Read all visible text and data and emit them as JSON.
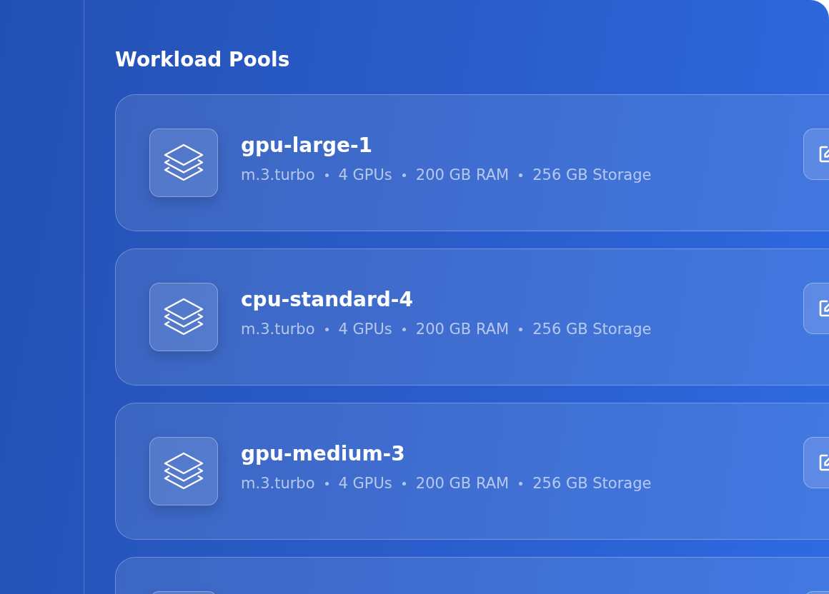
{
  "section": {
    "title": "Workload Pools"
  },
  "pools": [
    {
      "kind": "full",
      "name": "gpu-large-1",
      "specs": [
        "m.3.turbo",
        "4 GPUs",
        "200 GB RAM",
        "256 GB Storage"
      ]
    },
    {
      "kind": "full",
      "name": "cpu-standard-4",
      "specs": [
        "m.3.turbo",
        "4 GPUs",
        "200 GB RAM",
        "256 GB Storage"
      ]
    },
    {
      "kind": "full",
      "name": "gpu-medium-3",
      "specs": [
        "m.3.turbo",
        "4 GPUs",
        "200 GB RAM",
        "256 GB Storage"
      ]
    },
    {
      "kind": "partial"
    }
  ]
}
